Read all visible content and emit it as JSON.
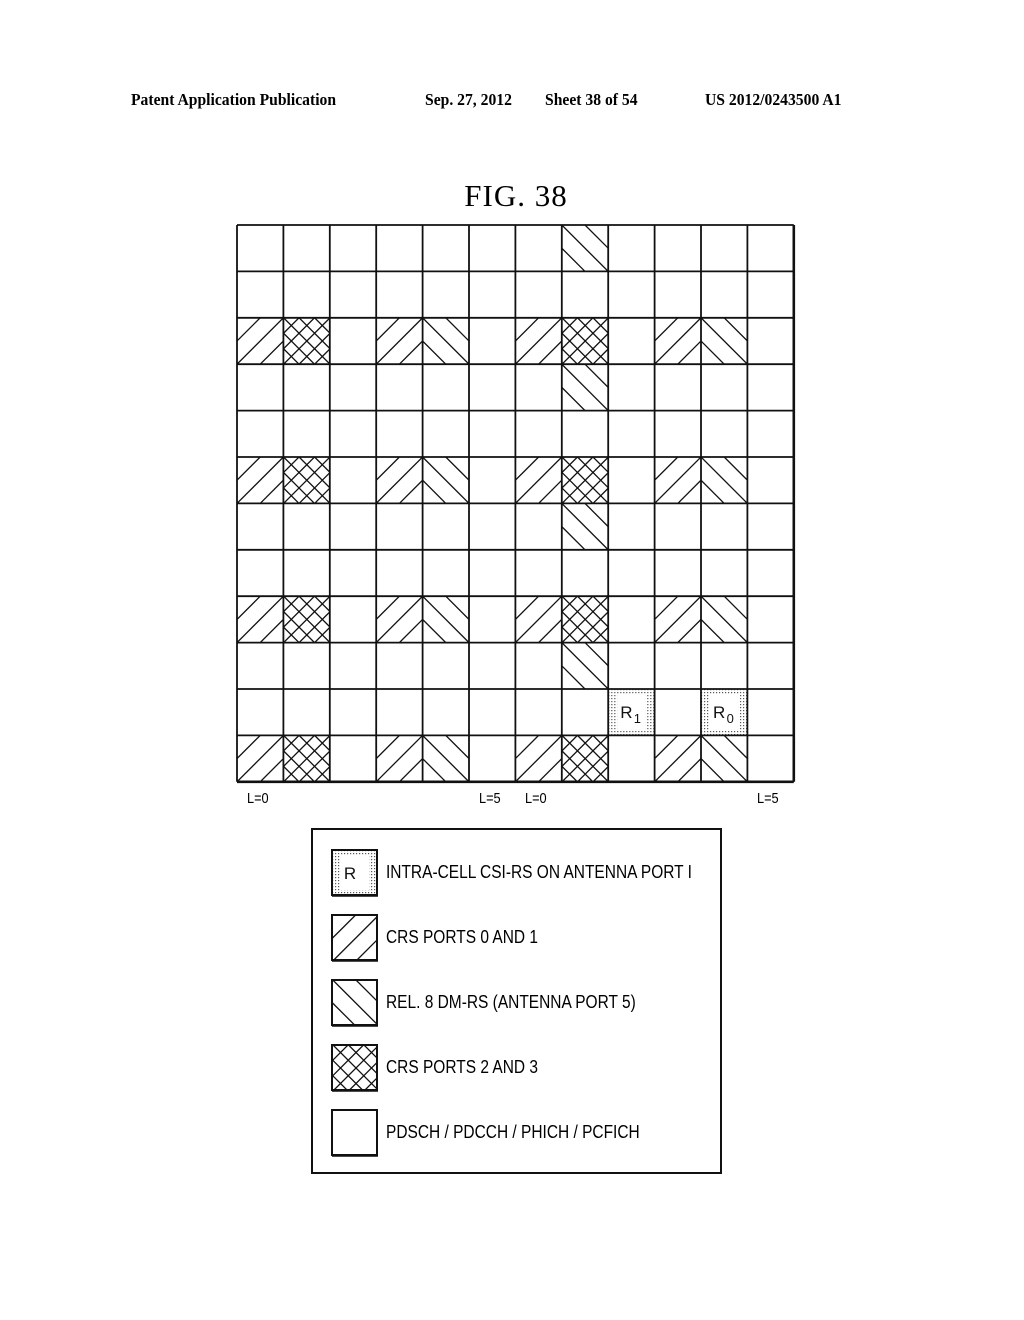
{
  "header": {
    "publication": "Patent Application Publication",
    "date": "Sep. 27, 2012",
    "sheet": "Sheet 38 of 54",
    "number": "US 2012/0243500 A1"
  },
  "figure": {
    "title": "FIG. 38"
  },
  "grid": {
    "columns": 12,
    "rows": 12,
    "cell_types": {
      "empty": "PDSCH / PDCCH / PHICH / PCFICH",
      "fwd": "CRS PORTS 0 AND 1",
      "back": "REL. 8 DM-RS (ANTENNA PORT 5)",
      "cross": "CRS PORTS 2 AND 3",
      "csirs": "INTRA-CELL CSI-RS ON ANTENNA PORT I"
    },
    "cells": [
      [
        "empty",
        "empty",
        "empty",
        "empty",
        "empty",
        "empty",
        "empty",
        "back",
        "empty",
        "empty",
        "empty",
        "empty"
      ],
      [
        "empty",
        "empty",
        "empty",
        "empty",
        "empty",
        "empty",
        "empty",
        "empty",
        "empty",
        "empty",
        "empty",
        "empty"
      ],
      [
        "fwd",
        "cross",
        "empty",
        "fwd",
        "back",
        "empty",
        "fwd",
        "cross",
        "empty",
        "fwd",
        "back",
        "empty"
      ],
      [
        "empty",
        "empty",
        "empty",
        "empty",
        "empty",
        "empty",
        "empty",
        "back",
        "empty",
        "empty",
        "empty",
        "empty"
      ],
      [
        "empty",
        "empty",
        "empty",
        "empty",
        "empty",
        "empty",
        "empty",
        "empty",
        "empty",
        "empty",
        "empty",
        "empty"
      ],
      [
        "fwd",
        "cross",
        "empty",
        "fwd",
        "back",
        "empty",
        "fwd",
        "cross",
        "empty",
        "fwd",
        "back",
        "empty"
      ],
      [
        "empty",
        "empty",
        "empty",
        "empty",
        "empty",
        "empty",
        "empty",
        "back",
        "empty",
        "empty",
        "empty",
        "empty"
      ],
      [
        "empty",
        "empty",
        "empty",
        "empty",
        "empty",
        "empty",
        "empty",
        "empty",
        "empty",
        "empty",
        "empty",
        "empty"
      ],
      [
        "fwd",
        "cross",
        "empty",
        "fwd",
        "back",
        "empty",
        "fwd",
        "cross",
        "empty",
        "fwd",
        "back",
        "empty"
      ],
      [
        "empty",
        "empty",
        "empty",
        "empty",
        "empty",
        "empty",
        "empty",
        "back",
        "empty",
        "empty",
        "empty",
        "empty"
      ],
      [
        "empty",
        "empty",
        "empty",
        "empty",
        "empty",
        "empty",
        "empty",
        "empty",
        "csirs",
        "empty",
        "csirs",
        "empty"
      ],
      [
        "fwd",
        "cross",
        "empty",
        "fwd",
        "back",
        "empty",
        "fwd",
        "cross",
        "empty",
        "fwd",
        "back",
        "empty"
      ]
    ],
    "csirs_labels": [
      {
        "row": 10,
        "col": 8,
        "letter": "R",
        "subscript": "1"
      },
      {
        "row": 10,
        "col": 10,
        "letter": "R",
        "subscript": "0"
      }
    ],
    "axis_labels": [
      {
        "text": "L=0",
        "col": 0
      },
      {
        "text": "L=5",
        "col": 5
      },
      {
        "text": "L=0",
        "col": 6
      },
      {
        "text": "L=5",
        "col": 11
      }
    ]
  },
  "legend": {
    "items": [
      {
        "type": "csirs",
        "swatch_text": "R",
        "label": "INTRA-CELL CSI-RS ON ANTENNA PORT I"
      },
      {
        "type": "fwd",
        "swatch_text": "",
        "label": "CRS PORTS 0 AND 1"
      },
      {
        "type": "back",
        "swatch_text": "",
        "label": "REL. 8 DM-RS (ANTENNA PORT 5)"
      },
      {
        "type": "cross",
        "swatch_text": "",
        "label": "CRS PORTS 2 AND 3"
      },
      {
        "type": "empty",
        "swatch_text": "",
        "label": "PDSCH / PDCCH / PHICH / PCFICH"
      }
    ]
  },
  "colors": {
    "line": "#111111",
    "background": "#ffffff",
    "dots": "#555555"
  }
}
